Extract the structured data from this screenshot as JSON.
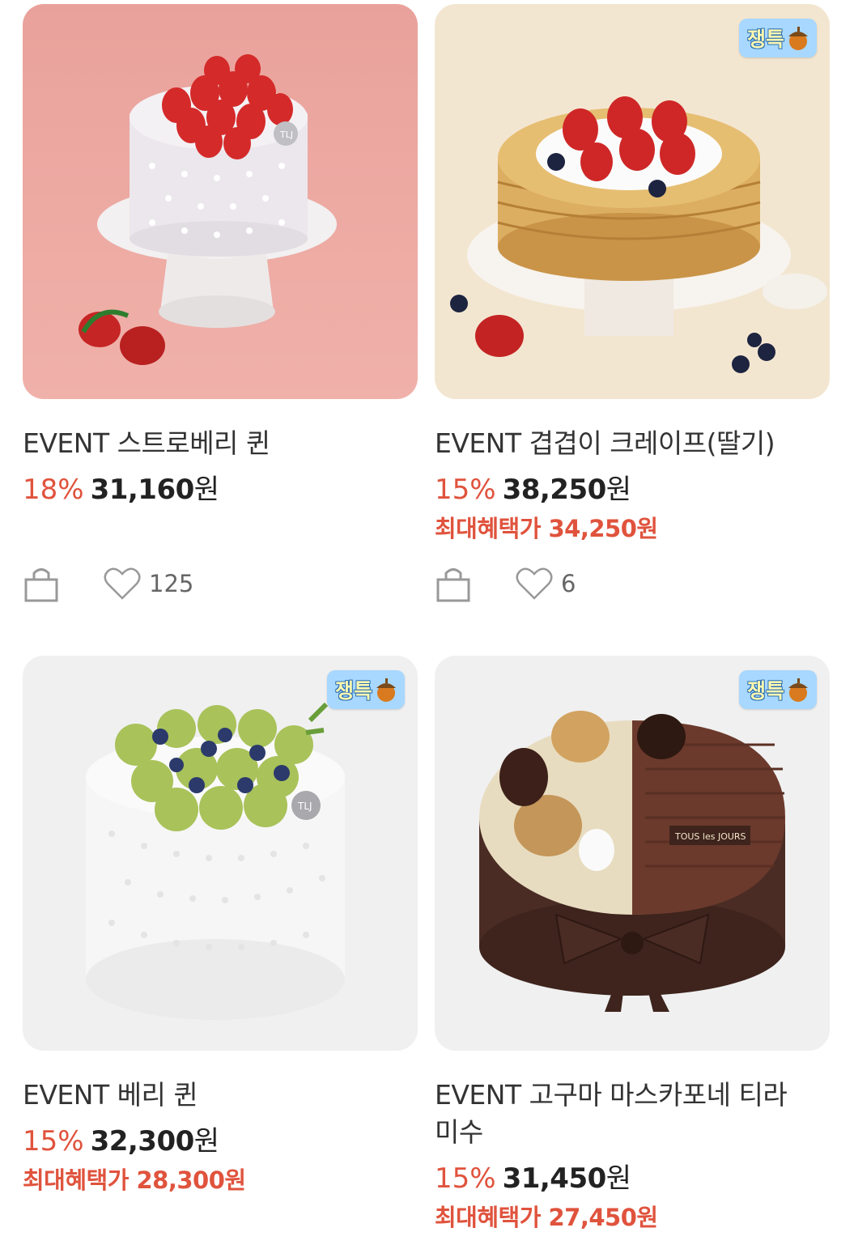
{
  "badge_label": "쟁특",
  "products": [
    {
      "title": "EVENT 스트로베리 퀸",
      "discount": "18%",
      "price": "31,160",
      "currency": "원",
      "benefit_label": "",
      "benefit_price": "",
      "likes": "125",
      "badge": false
    },
    {
      "title": "EVENT 겹겹이 크레이프(딸기)",
      "discount": "15%",
      "price": "38,250",
      "currency": "원",
      "benefit_label": "최대혜택가 34,250원",
      "likes": "6",
      "badge": true
    },
    {
      "title": "EVENT 베리 퀸",
      "discount": "15%",
      "price": "32,300",
      "currency": "원",
      "benefit_label": "최대혜택가 28,300원",
      "badge": true
    },
    {
      "title_line1": "EVENT 고구마 마스카포네 티라",
      "title_line2": "미수",
      "discount": "15%",
      "price": "31,450",
      "currency": "원",
      "benefit_label": "최대혜택가 27,450원",
      "badge": true
    }
  ],
  "colors": {
    "accent": "#e0533d",
    "badge_bg": "#a8d8ff"
  }
}
